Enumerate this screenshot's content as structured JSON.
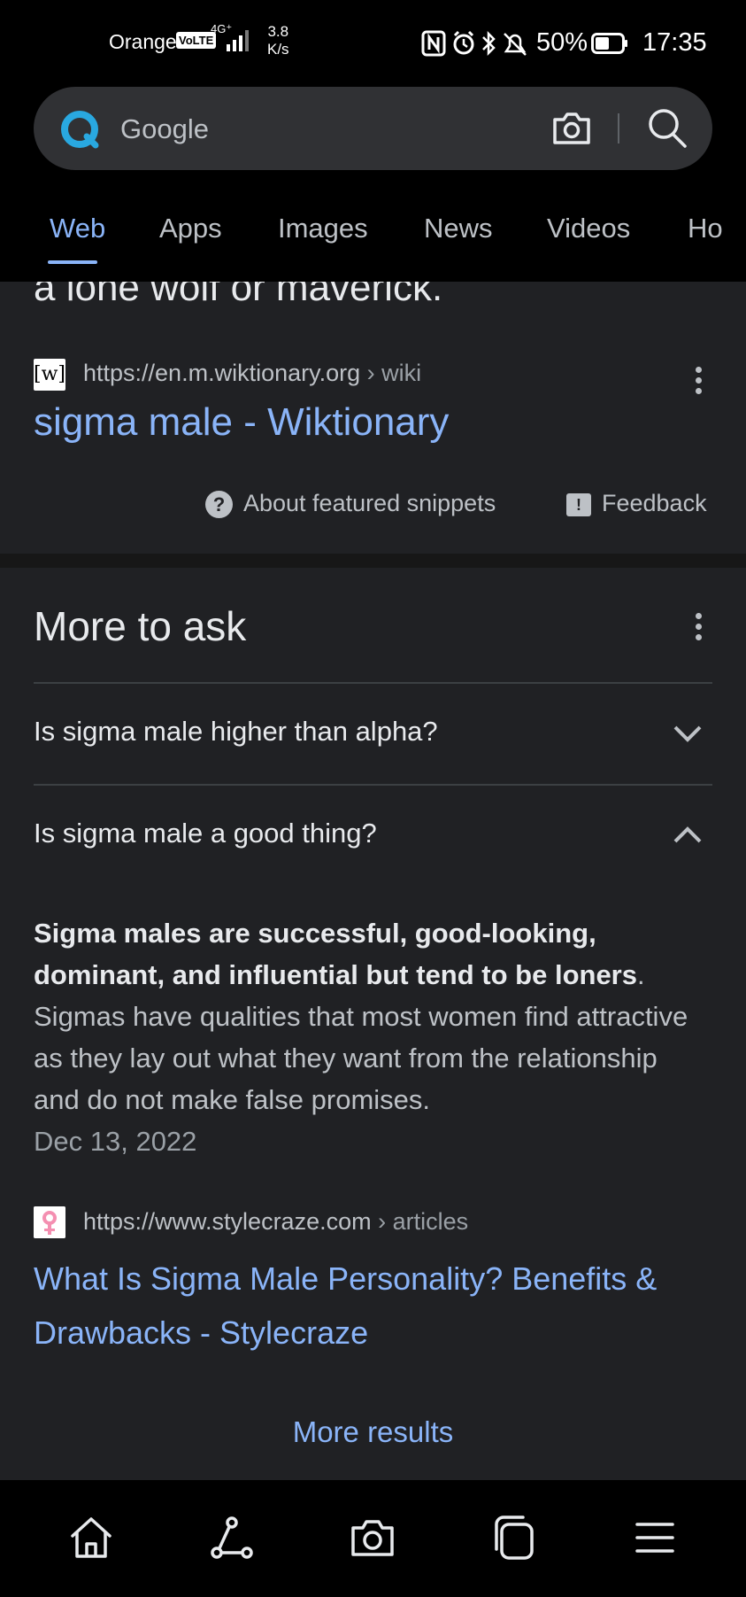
{
  "status_bar": {
    "carrier": "Orange",
    "volte": "VoLTE",
    "network": "4G⁺",
    "speed_value": "3.8",
    "speed_unit": "K/s",
    "battery": "50%",
    "time": "17:35"
  },
  "search": {
    "query": "Google"
  },
  "tabs": [
    "Web",
    "Apps",
    "Images",
    "News",
    "Videos",
    "Ho"
  ],
  "featured": {
    "clipped_text": "a lone wolf or maverick.",
    "favicon_text": "[w]",
    "url": "https://en.m.wiktionary.org",
    "breadcrumb": " › wiki",
    "title": "sigma male - Wiktionary",
    "about_label": "About featured snippets",
    "feedback_label": "Feedback"
  },
  "more_to_ask": {
    "title": "More to ask",
    "questions": [
      "Is sigma male higher than alpha?",
      "Is sigma male a good thing?"
    ],
    "answer_bold": "Sigma males are successful, good-looking, dominant, and influential but tend to be loners",
    "answer_rest": ". Sigmas have qualities that most women find attractive as they lay out what they want from the relationship and do not make false promises.",
    "answer_date": "Dec 13, 2022",
    "source_url": "https://www.stylecraze.com",
    "source_breadcrumb": " › articles",
    "source_title": "What Is Sigma Male Personality? Benefits & Drawbacks - Stylecraze",
    "more_results": "More results"
  },
  "bottom_nav": [
    "home-icon",
    "share-icon",
    "camera-icon",
    "tabs-icon",
    "menu-icon"
  ]
}
